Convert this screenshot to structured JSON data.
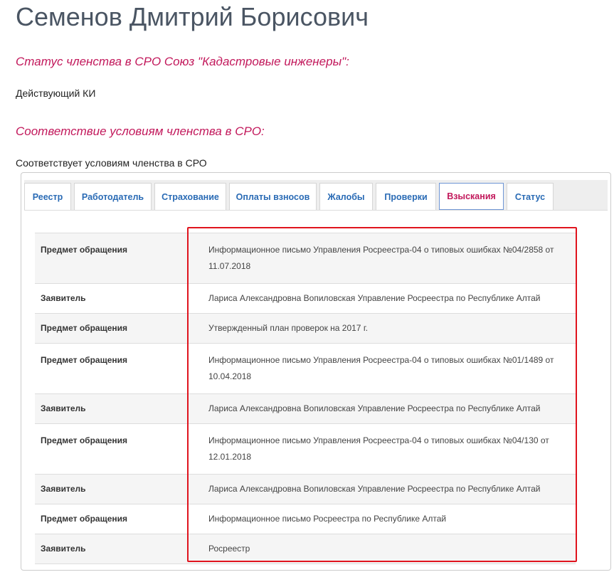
{
  "person": {
    "name": "Семенов Дмитрий Борисович"
  },
  "membership": {
    "status_heading": "Статус членства в СРО Союз \"Кадастровые инженеры\":",
    "status_value": "Действующий КИ",
    "conformity_heading": "Соответствие условиям членства в СРО:",
    "conformity_value": "Соответствует условиям членства в СРО"
  },
  "tabs": [
    {
      "label": "Реестр",
      "active": false
    },
    {
      "label": "Работодатель",
      "active": false
    },
    {
      "label": "Страхование",
      "active": false
    },
    {
      "label": "Оплаты взносов",
      "active": false
    },
    {
      "label": "Жалобы",
      "active": false
    },
    {
      "label": "Проверки",
      "active": false
    },
    {
      "label": "Взыскания",
      "active": true
    },
    {
      "label": "Статус",
      "active": false
    }
  ],
  "records": [
    {
      "label": "Предмет обращения",
      "value": "Информационное письмо Управления Росреестра-04 о типовых ошибках №04/2858 от 11.07.2018"
    },
    {
      "label": "Заявитель",
      "value": "Лариса Александровна Вопиловская Управление Росреестра по Республике Алтай"
    },
    {
      "label": "Предмет обращения",
      "value": "Утвержденный план проверок на 2017 г."
    },
    {
      "label": "Предмет обращения",
      "value": "Информационное письмо Управления Росреестра-04 о типовых ошибках №01/1489 от 10.04.2018"
    },
    {
      "label": "Заявитель",
      "value": "Лариса Александровна Вопиловская Управление Росреестра по Республике Алтай"
    },
    {
      "label": "Предмет обращения",
      "value": "Информационное письмо Управления Росреестра-04 о типовых ошибках №04/130 от 12.01.2018"
    },
    {
      "label": "Заявитель",
      "value": "Лариса Александровна Вопиловская Управление Росреестра по Республике Алтай"
    },
    {
      "label": "Предмет обращения",
      "value": "Информационное письмо Росреестра по Республике Алтай"
    },
    {
      "label": "Заявитель",
      "value": "Росреестр"
    }
  ],
  "colors": {
    "heading_accent": "#c2185b",
    "tab_link": "#2a6bb5",
    "highlight_border": "#e0141e"
  }
}
